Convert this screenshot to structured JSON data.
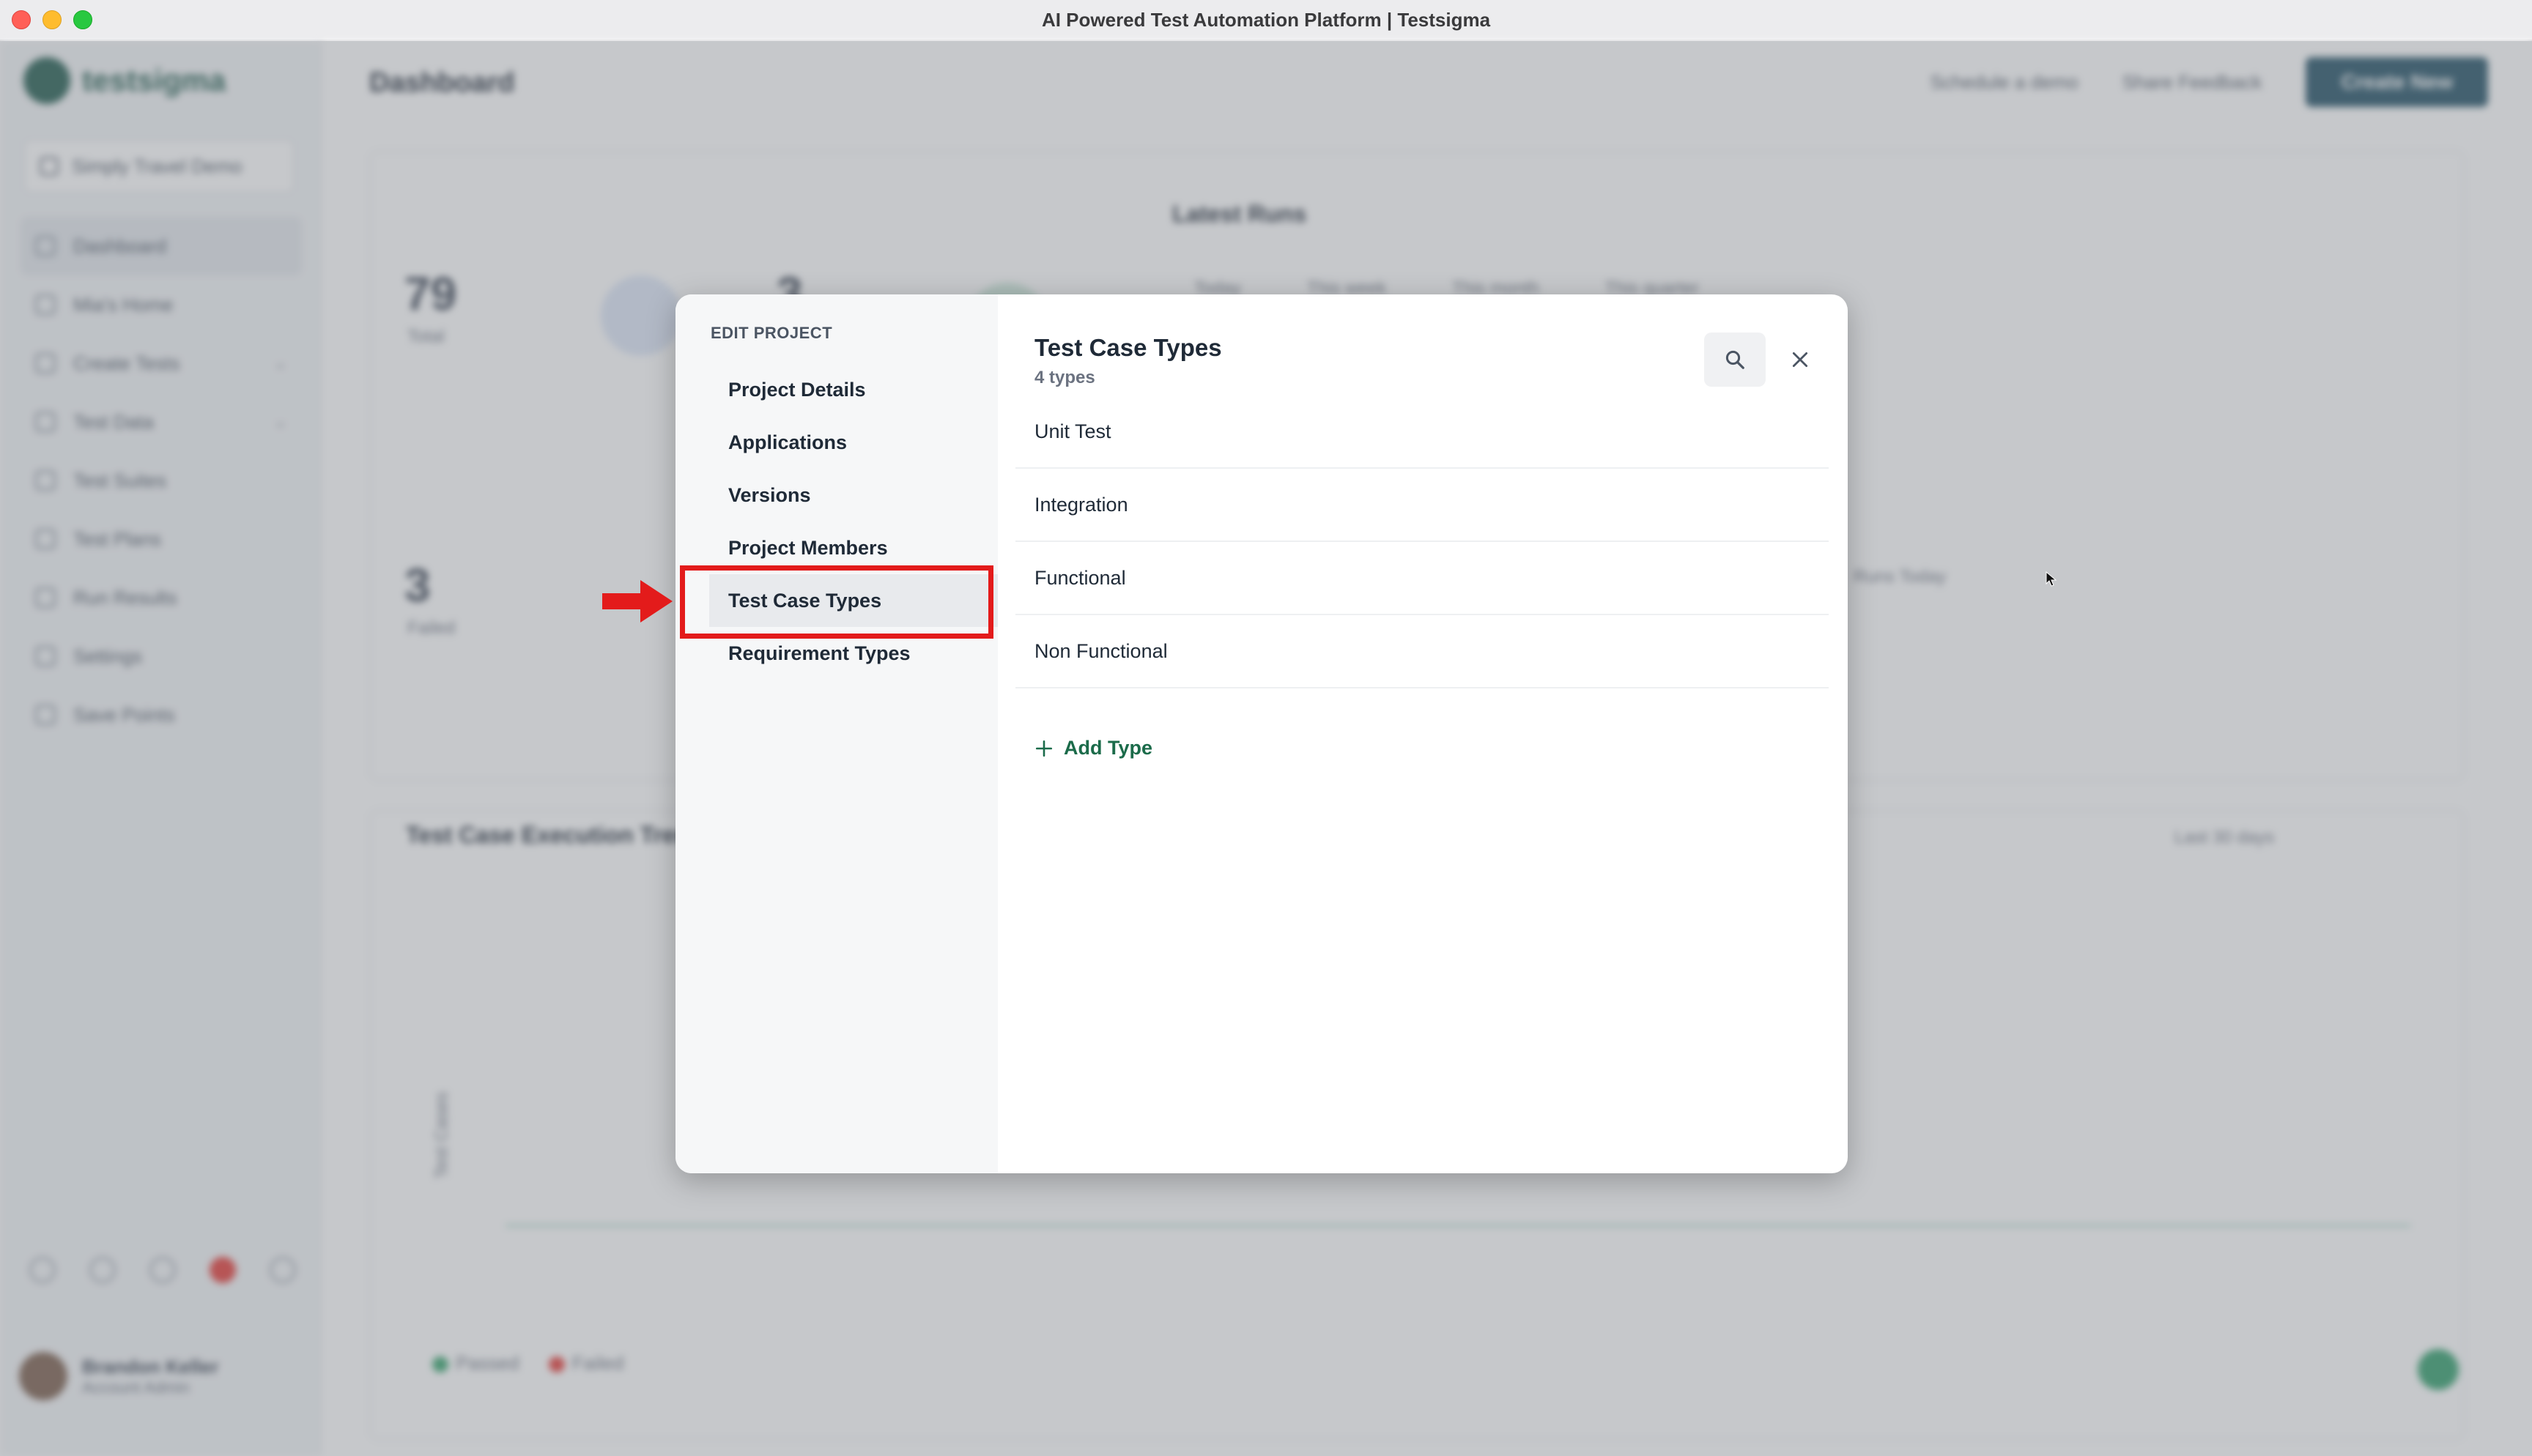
{
  "window": {
    "title": "AI Powered Test Automation Platform | Testsigma"
  },
  "app": {
    "brand": "testsigma",
    "project_selector": "Simply Travel Demo",
    "nav": [
      {
        "label": "Dashboard",
        "icon": "home-icon"
      },
      {
        "label": "Mia's Home",
        "icon": "user-icon"
      },
      {
        "label": "Create Tests",
        "icon": "pencil-icon"
      },
      {
        "label": "Test Data",
        "icon": "table-icon"
      },
      {
        "label": "Test Suites",
        "icon": "folder-icon"
      },
      {
        "label": "Test Plans",
        "icon": "plan-icon"
      },
      {
        "label": "Run Results",
        "icon": "chart-icon"
      },
      {
        "label": "Settings",
        "icon": "gear-icon"
      },
      {
        "label": "Save Points",
        "icon": "bookmark-icon"
      }
    ],
    "user": {
      "name": "Brandon Keller",
      "role": "Account Admin"
    },
    "page_title": "Dashboard",
    "top_actions": {
      "schedule": "Schedule a demo",
      "feedback": "Share Feedback",
      "create": "Create New"
    },
    "stats": {
      "total_value": "79",
      "total_label": "Total",
      "failed_value": "3",
      "failed_label": "Failed",
      "second_value": "3"
    },
    "latest_runs": {
      "title": "Latest Runs",
      "filters": [
        "Today",
        "This week",
        "This month",
        "This quarter"
      ]
    },
    "execution_chart": {
      "title": "Test Case Execution Trend",
      "range": "Last 30 days",
      "y_label": "Test Cases",
      "legend": [
        "Passed",
        "Failed"
      ],
      "side_note": "Runs Today"
    }
  },
  "modal": {
    "section_label": "EDIT PROJECT",
    "menu": [
      {
        "label": "Project Details"
      },
      {
        "label": "Applications"
      },
      {
        "label": "Versions"
      },
      {
        "label": "Project Members"
      },
      {
        "label": "Test Case Types"
      },
      {
        "label": "Requirement Types"
      }
    ],
    "active_menu": "Test Case Types",
    "title": "Test Case Types",
    "count": "4 types",
    "types": [
      "Unit Test",
      "Integration",
      "Functional",
      "Non Functional"
    ],
    "add_label": "Add Type"
  },
  "colors": {
    "accent": "#1b6b4a",
    "annotation": "#e31b1b",
    "create_button": "#1f4e63"
  }
}
